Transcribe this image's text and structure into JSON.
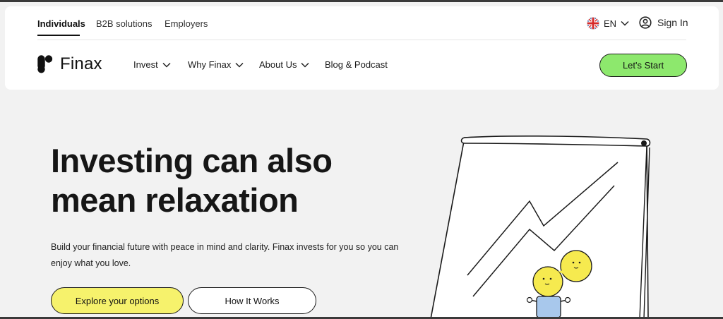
{
  "segments": {
    "individuals": "Individuals",
    "b2b": "B2B solutions",
    "employers": "Employers"
  },
  "language": {
    "code": "EN",
    "flag_icon": "uk-flag-icon"
  },
  "account": {
    "signin_label": "Sign In"
  },
  "brand": {
    "name": "Finax"
  },
  "nav": {
    "invest": "Invest",
    "why": "Why Finax",
    "about": "About Us",
    "blog": "Blog & Podcast"
  },
  "cta": {
    "start_label": "Let's Start"
  },
  "hero": {
    "title_line1": "Investing can also",
    "title_line2": "mean relaxation",
    "desc_line1": "Build your financial future with peace in mind and clarity. Finax invests for you so you can",
    "desc_line2": "enjoy what you love.",
    "primary_label": "Explore your options",
    "secondary_label": "How It Works"
  },
  "colors": {
    "accent_green": "#8de86d",
    "accent_yellow": "#f6f26c",
    "background": "#f2f2f2"
  }
}
